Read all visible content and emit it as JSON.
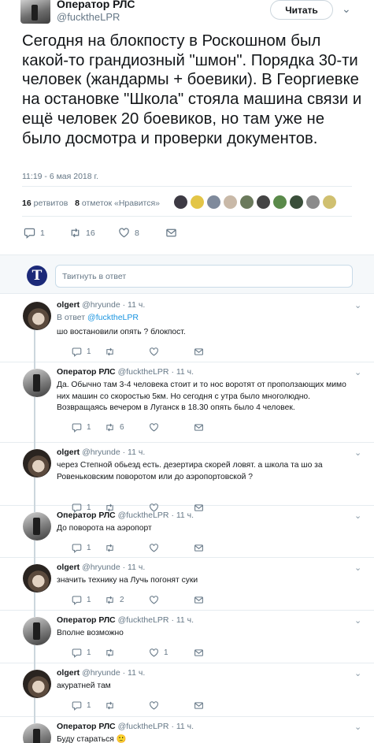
{
  "tweet": {
    "author_name": "Оператор РЛС",
    "author_handle": "@fucktheLPR",
    "follow_label": "Читать",
    "text": "Сегодня на блокпосту в Роскошном был какой-то грандиозный \"шмон\". Порядка 30-ти человек (жандармы + боевики). В Георгиевке на остановке \"Школа\" стояла машина связи и ещё человек 20 боевиков, но там уже не было досмотра и проверки документов.",
    "timestamp": "11:19 - 6 мая 2018 г.",
    "retweets_count": "16",
    "retweets_label": "ретвитов",
    "likes_count": "8",
    "likes_label": "отметок «Нравится»",
    "replies_stat": "1",
    "retweets_stat": "16",
    "likes_stat": "8"
  },
  "liker_colors": [
    "#3d3a44",
    "#e3c547",
    "#7f8a9c",
    "#c9b9a8",
    "#6b7a5c",
    "#444444",
    "#5a8a4a",
    "#3a4f3a",
    "#8a8a8a",
    "#d0c070"
  ],
  "reply_box": {
    "placeholder": "Твитнуть в ответ",
    "avatar_letter": "T"
  },
  "replies": [
    {
      "name": "olgert",
      "handle": "@hryunde",
      "time": "· 11 ч.",
      "reply_to_prefix": "В ответ",
      "reply_to_handle": "@fucktheLPR",
      "text": "шо востановили опять ? блокпост.",
      "reply_count": "1",
      "retweet_count": "",
      "like_count": ""
    },
    {
      "name": "Оператор РЛС",
      "handle": "@fucktheLPR",
      "time": "· 11 ч.",
      "text": "Да. Обычно там 3-4 человека стоит и то нос воротят от проползающих мимо них машин со скоростью 5км. Но сегодня с утра было многолюдно. Возвращаясь вечером в Луганск в 18.30 опять было 4 человек.",
      "reply_count": "1",
      "retweet_count": "6",
      "like_count": ""
    },
    {
      "name": "olgert",
      "handle": "@hryunde",
      "time": "· 11 ч.",
      "text": "через Степной обьезд есть. дезертира скорей ловят. а школа та шо за Ровеньковским поворотом или до аэропортовской ?",
      "reply_count": "1",
      "retweet_count": "",
      "like_count": ""
    },
    {
      "name": "Оператор РЛС",
      "handle": "@fucktheLPR",
      "time": "· 11 ч.",
      "text": "До поворота на аэропорт",
      "reply_count": "1",
      "retweet_count": "",
      "like_count": ""
    },
    {
      "name": "olgert",
      "handle": "@hryunde",
      "time": "· 11 ч.",
      "text": "значить технику на Лучь погонят суки",
      "reply_count": "1",
      "retweet_count": "2",
      "like_count": ""
    },
    {
      "name": "Оператор РЛС",
      "handle": "@fucktheLPR",
      "time": "· 11 ч.",
      "text": "Вполне возможно",
      "reply_count": "1",
      "retweet_count": "",
      "like_count": "1"
    },
    {
      "name": "olgert",
      "handle": "@hryunde",
      "time": "· 11 ч.",
      "text": "акуратней там",
      "reply_count": "1",
      "retweet_count": "",
      "like_count": ""
    },
    {
      "name": "Оператор РЛС",
      "handle": "@fucktheLPR",
      "time": "· 11 ч.",
      "text": "Буду стараться 🙂",
      "reply_count": "",
      "retweet_count": "",
      "like_count": ""
    }
  ]
}
